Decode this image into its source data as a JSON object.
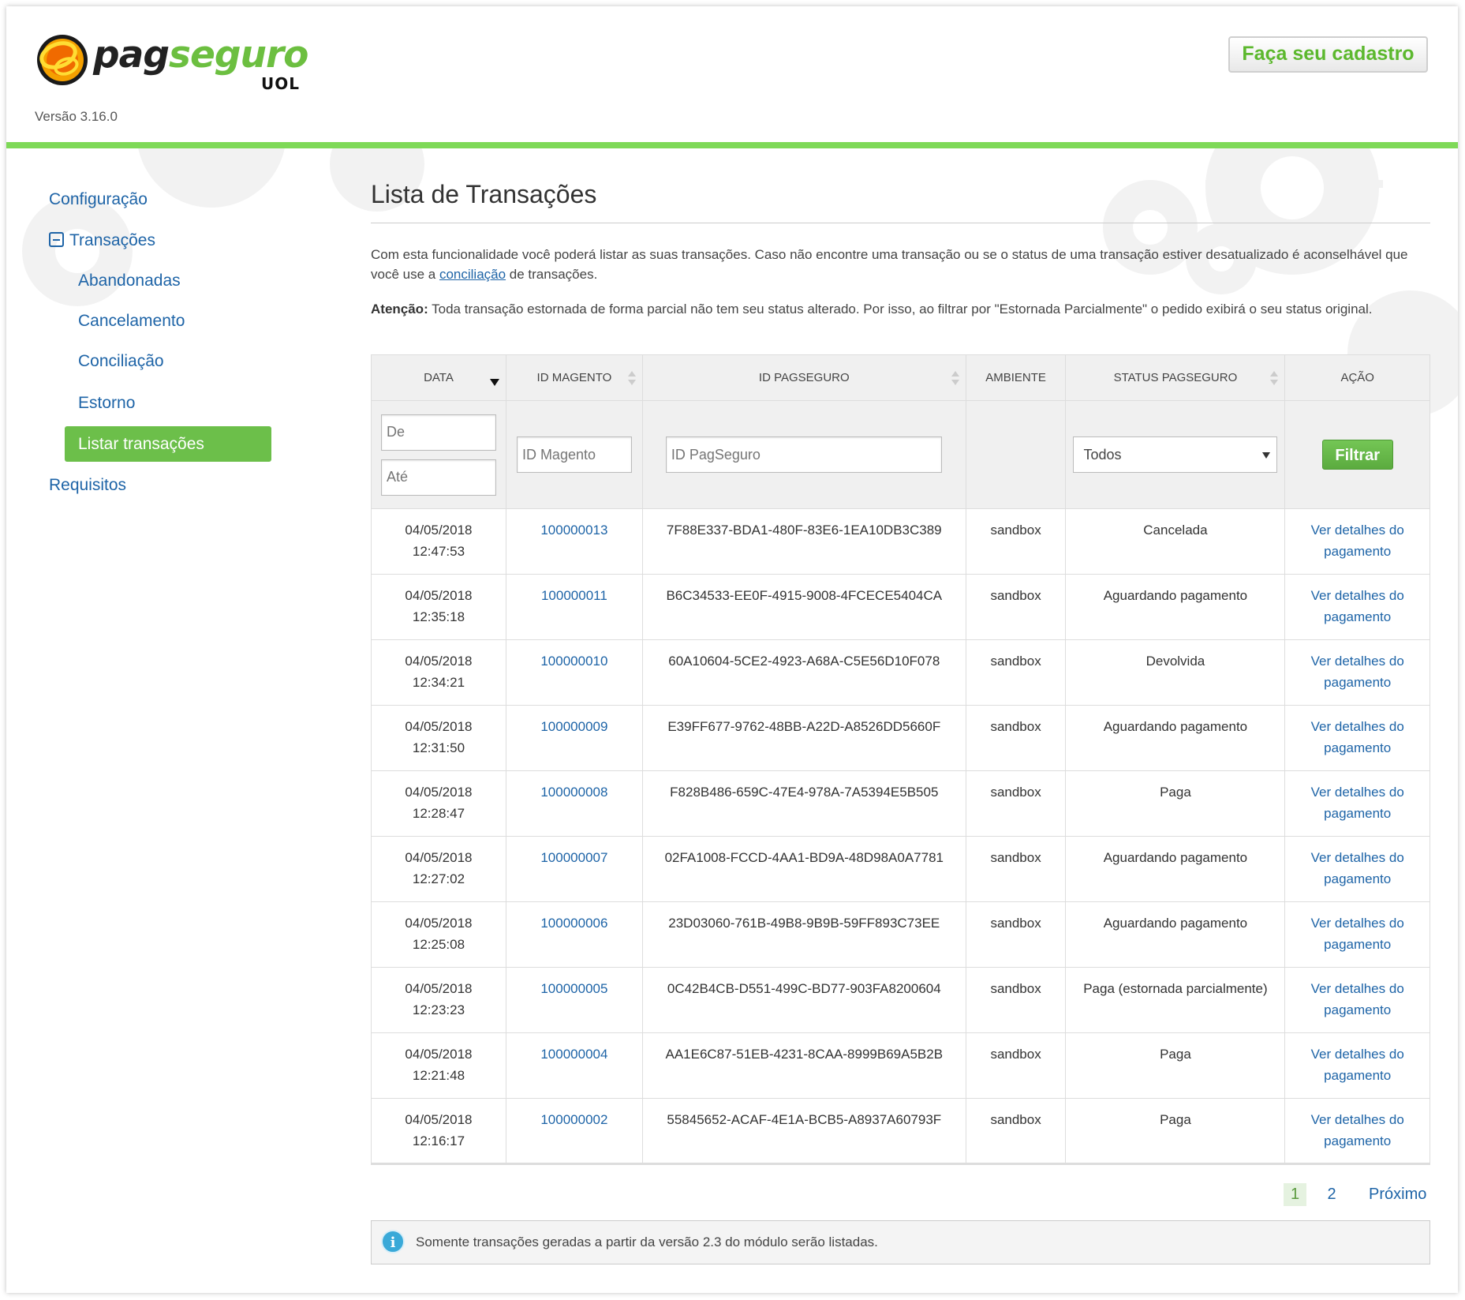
{
  "header": {
    "logo_pag": "pag",
    "logo_seguro": "seguro",
    "logo_uol": "UOL",
    "version": "Versão 3.16.0",
    "cadastro_label": "Faça seu cadastro"
  },
  "sidebar": {
    "items": [
      {
        "label": "Configuração"
      },
      {
        "label": "Transações"
      },
      {
        "label": "Abandonadas"
      },
      {
        "label": "Cancelamento"
      },
      {
        "label": "Conciliação"
      },
      {
        "label": "Estorno"
      },
      {
        "label": "Listar transações"
      },
      {
        "label": "Requisitos"
      }
    ]
  },
  "main": {
    "title": "Lista de Transações",
    "desc_before": "Com esta funcionalidade você poderá listar as suas transações. Caso não encontre uma transação ou se o status de uma transação estiver desatualizado é aconselhável que você use a ",
    "desc_link": "conciliação",
    "desc_after": " de transações.",
    "warn_label": "Atenção:",
    "warn_text": " Toda transação estornada de forma parcial não tem seu status alterado. Por isso, ao filtrar por \"Estornada Parcialmente\" o pedido exibirá o seu status original."
  },
  "table": {
    "headers": [
      "DATA",
      "ID MAGENTO",
      "ID PAGSEGURO",
      "AMBIENTE",
      "STATUS PAGSEGURO",
      "AÇÃO"
    ],
    "filters": {
      "de_placeholder": "De",
      "ate_placeholder": "Até",
      "id_magento_placeholder": "ID Magento",
      "id_pagseguro_placeholder": "ID PagSeguro",
      "status_selected": "Todos",
      "filter_button": "Filtrar"
    },
    "action_line1": "Ver detalhes do",
    "action_line2": "pagamento",
    "rows": [
      {
        "date": "04/05/2018",
        "time": "12:47:53",
        "id_magento": "100000013",
        "id_pagseguro": "7F88E337-BDA1-480F-83E6-1EA10DB3C389",
        "ambiente": "sandbox",
        "status": "Cancelada"
      },
      {
        "date": "04/05/2018",
        "time": "12:35:18",
        "id_magento": "100000011",
        "id_pagseguro": "B6C34533-EE0F-4915-9008-4FCECE5404CA",
        "ambiente": "sandbox",
        "status": "Aguardando pagamento"
      },
      {
        "date": "04/05/2018",
        "time": "12:34:21",
        "id_magento": "100000010",
        "id_pagseguro": "60A10604-5CE2-4923-A68A-C5E56D10F078",
        "ambiente": "sandbox",
        "status": "Devolvida"
      },
      {
        "date": "04/05/2018",
        "time": "12:31:50",
        "id_magento": "100000009",
        "id_pagseguro": "E39FF677-9762-48BB-A22D-A8526DD5660F",
        "ambiente": "sandbox",
        "status": "Aguardando pagamento"
      },
      {
        "date": "04/05/2018",
        "time": "12:28:47",
        "id_magento": "100000008",
        "id_pagseguro": "F828B486-659C-47E4-978A-7A5394E5B505",
        "ambiente": "sandbox",
        "status": "Paga"
      },
      {
        "date": "04/05/2018",
        "time": "12:27:02",
        "id_magento": "100000007",
        "id_pagseguro": "02FA1008-FCCD-4AA1-BD9A-48D98A0A7781",
        "ambiente": "sandbox",
        "status": "Aguardando pagamento"
      },
      {
        "date": "04/05/2018",
        "time": "12:25:08",
        "id_magento": "100000006",
        "id_pagseguro": "23D03060-761B-49B8-9B9B-59FF893C73EE",
        "ambiente": "sandbox",
        "status": "Aguardando pagamento"
      },
      {
        "date": "04/05/2018",
        "time": "12:23:23",
        "id_magento": "100000005",
        "id_pagseguro": "0C42B4CB-D551-499C-BD77-903FA8200604",
        "ambiente": "sandbox",
        "status": "Paga (estornada parcialmente)"
      },
      {
        "date": "04/05/2018",
        "time": "12:21:48",
        "id_magento": "100000004",
        "id_pagseguro": "AA1E6C87-51EB-4231-8CAA-8999B69A5B2B",
        "ambiente": "sandbox",
        "status": "Paga"
      },
      {
        "date": "04/05/2018",
        "time": "12:16:17",
        "id_magento": "100000002",
        "id_pagseguro": "55845652-ACAF-4E1A-BCB5-A8937A60793F",
        "ambiente": "sandbox",
        "status": "Paga"
      }
    ]
  },
  "pagination": {
    "page1": "1",
    "page2": "2",
    "next": "Próximo"
  },
  "info": {
    "icon_glyph": "i",
    "text": "Somente transações geradas a partir da versão 2.3 do módulo serão listadas."
  },
  "colors": {
    "brand_green": "#7ed957",
    "active_green": "#6cbf4a",
    "link_blue": "#1e64a7",
    "info_blue": "#3aa9d8"
  }
}
